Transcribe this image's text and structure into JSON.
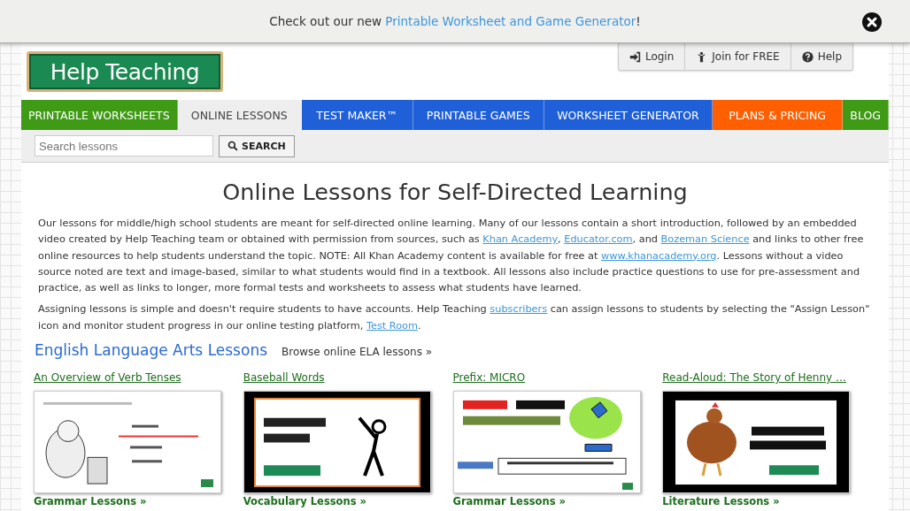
{
  "banner": {
    "parts": [
      {
        "text": "Check out our new ",
        "link": false
      },
      {
        "text": "Printable Worksheet and Game Generator",
        "link": true
      },
      {
        "text": "!",
        "link": false
      }
    ]
  },
  "logo": "Help Teaching",
  "account_menu": [
    {
      "label": "Login",
      "kind": "login"
    },
    {
      "label": "Join for FREE",
      "kind": "join"
    },
    {
      "label": "Help",
      "kind": "help"
    }
  ],
  "nav": [
    {
      "label": "PRINTABLE WORKSHEETS",
      "color": "#3f9a16",
      "selected": false
    },
    {
      "label": "ONLINE LESSONS",
      "selected": true
    },
    {
      "label": "TEST MAKER™",
      "color": "#1f5fd8",
      "selected": false
    },
    {
      "label": "PRINTABLE GAMES",
      "color": "#1f5fd8",
      "selected": false
    },
    {
      "label": "WORKSHEET GENERATOR",
      "color": "#1f5fd8",
      "selected": false
    },
    {
      "label": "PLANS & PRICING",
      "color": "#ff5f00",
      "selected": false
    },
    {
      "label": "BLOG",
      "color": "#3f9a16",
      "selected": false
    }
  ],
  "search": {
    "placeholder": "Search lessons",
    "button": "SEARCH"
  },
  "heading": "Online Lessons for Self-Directed Learning",
  "paragraphs": [
    [
      {
        "text": "Our lessons for middle/high school students are meant for self-directed online learning. Many of our lessons contain a short introduction, followed by an embedded video created by Help Teaching team or obtained with permission from sources, such as ",
        "link": false
      },
      {
        "text": "Khan Academy",
        "link": true
      },
      {
        "text": ", ",
        "link": false
      },
      {
        "text": "Educator.com",
        "link": true
      },
      {
        "text": ", and ",
        "link": false
      },
      {
        "text": "Bozeman Science",
        "link": true
      },
      {
        "text": " and links to other free online resources to help students understand the topic. NOTE: All Khan Academy content is available for free at ",
        "link": false
      },
      {
        "text": "www.khanacademy.org",
        "link": true
      },
      {
        "text": ". Lessons without a video source noted are text and image-based, similar to what students would find in a textbook. All lessons also include practice questions to use for pre-assessment and practice, as well as links to longer, more formal tests and worksheets to assess what students have learned.",
        "link": false
      }
    ],
    [
      {
        "text": "Assigning lessons is simple and doesn't require students to have accounts. Help Teaching ",
        "link": false
      },
      {
        "text": "subscribers",
        "link": true
      },
      {
        "text": " can assign lessons to students by selecting the \"Assign Lesson\" icon and monitor student progress in our online testing platform, ",
        "link": false
      },
      {
        "text": "Test Room",
        "link": true
      },
      {
        "text": ".",
        "link": false
      }
    ]
  ],
  "section": {
    "title": "English Language Arts Lessons",
    "browse": "Browse online ELA lessons »"
  },
  "lessons": [
    {
      "title": "An Overview of Verb Tenses",
      "category": "Grammar Lessons »"
    },
    {
      "title": "Baseball Words",
      "category": "Vocabulary Lessons »"
    },
    {
      "title": "Prefix: MICRO",
      "category": "Grammar Lessons »"
    },
    {
      "title": "Read-Aloud: The Story of Henny …",
      "category": "Literature Lessons »"
    }
  ]
}
